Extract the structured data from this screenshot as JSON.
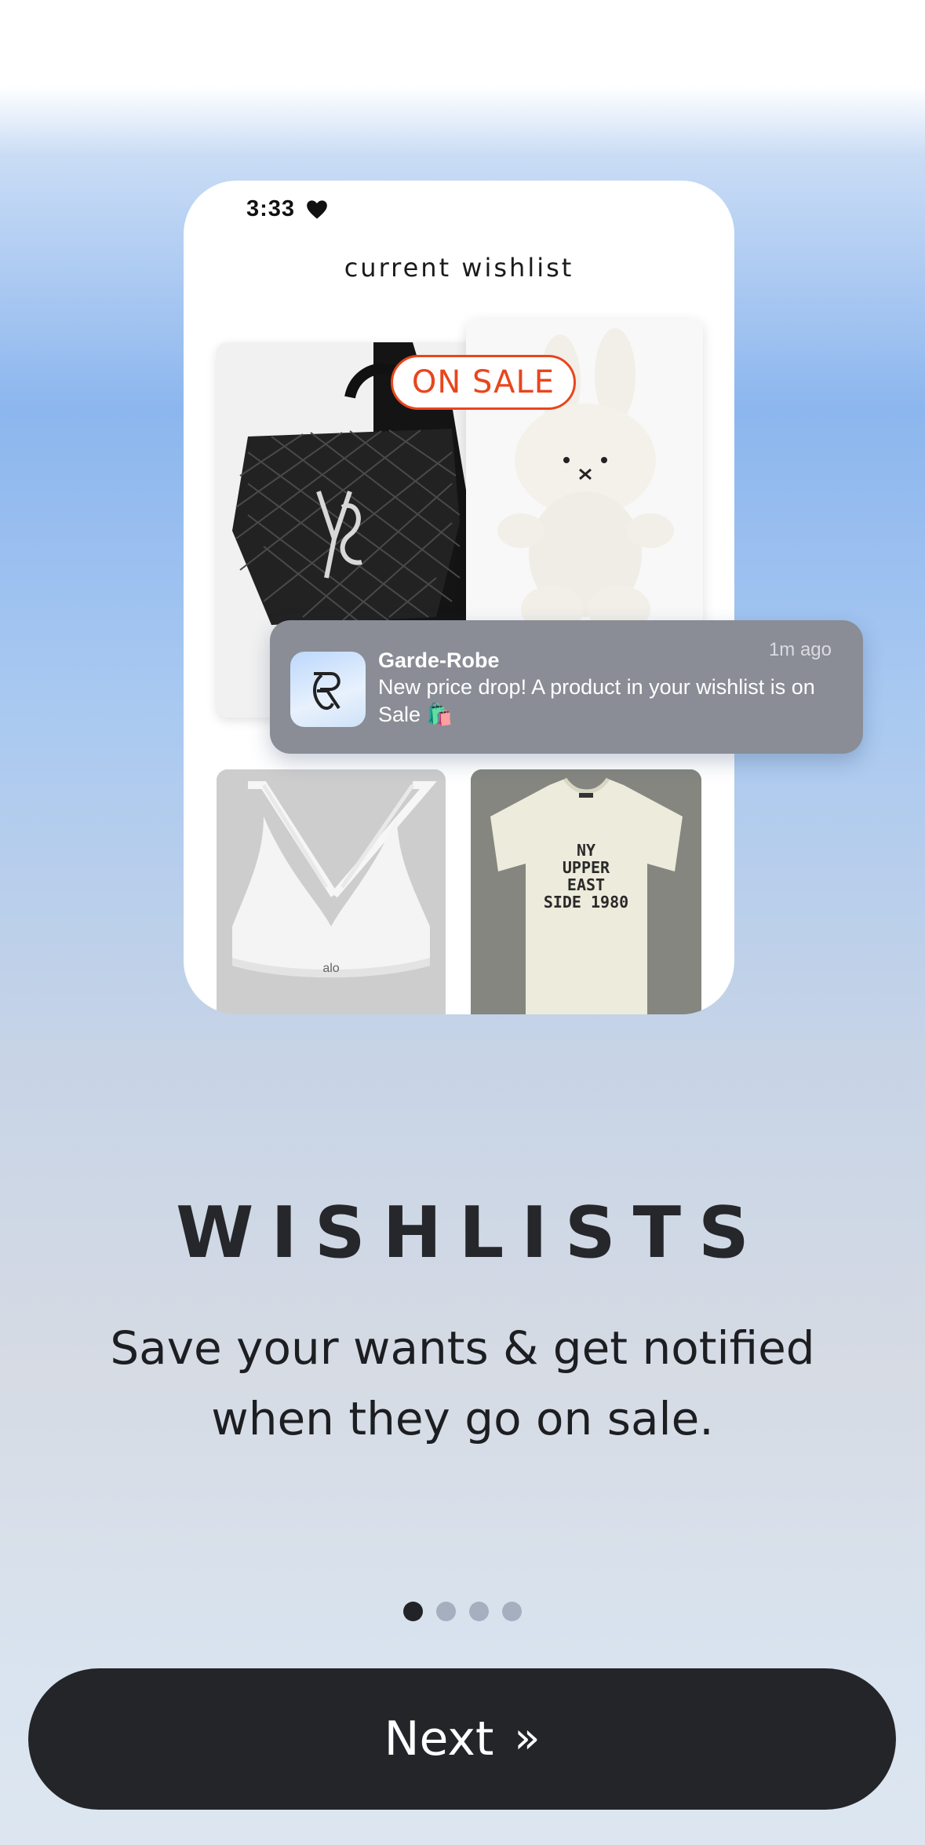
{
  "phone": {
    "status_time": "3:33",
    "title": "current wishlist",
    "sale_badge": "ON SALE",
    "shirt_print": [
      "NY",
      "UPPER",
      "EAST",
      "SIDE 1980"
    ],
    "bra_logo": "alo"
  },
  "notification": {
    "app_name": "Garde-Robe",
    "time": "1m ago",
    "message": "New price drop! A product in your wishlist is on Sale 🛍️",
    "icon": "garde-robe-logo-icon"
  },
  "content": {
    "heading": "WISHLISTS",
    "subtitle": "Save your wants & get notified when they go on sale."
  },
  "pagination": {
    "total": 4,
    "active": 0
  },
  "next_button": {
    "label": "Next",
    "icon": "double-chevron-right-icon"
  },
  "colors": {
    "accent_sale": "#e8461d",
    "button_bg": "#242528",
    "dot_active": "#222326",
    "dot_inactive": "#a5afc0"
  }
}
